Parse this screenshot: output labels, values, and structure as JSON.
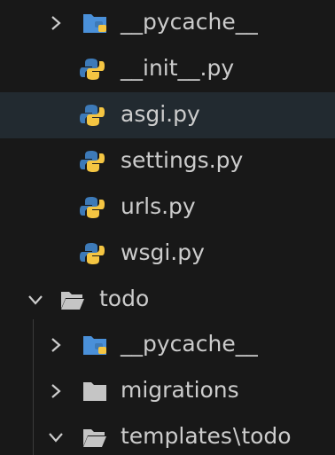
{
  "explorer": {
    "items": [
      {
        "label": "__pycache__",
        "type": "folder-python",
        "chevron": "chevron-right-icon"
      },
      {
        "label": "__init__.py",
        "type": "python-file"
      },
      {
        "label": "asgi.py",
        "type": "python-file",
        "selected": true
      },
      {
        "label": "settings.py",
        "type": "python-file"
      },
      {
        "label": "urls.py",
        "type": "python-file"
      },
      {
        "label": "wsgi.py",
        "type": "python-file"
      },
      {
        "label": "todo",
        "type": "folder-open",
        "chevron": "chevron-down-icon"
      },
      {
        "label": "__pycache__",
        "type": "folder-python",
        "chevron": "chevron-right-icon"
      },
      {
        "label": "migrations",
        "type": "folder",
        "chevron": "chevron-right-icon"
      },
      {
        "label_parts": [
          "templates",
          "\\",
          "todo"
        ],
        "type": "folder-open",
        "chevron": "chevron-down-icon"
      }
    ]
  },
  "colors": {
    "background": "#181818",
    "selected_row": "#222a30",
    "text": "#cccccc",
    "python_blue": "#3d7ab8",
    "python_yellow": "#f4c542",
    "folder_gray": "#c5c5c5",
    "folder_python_blue": "#4a90d9"
  }
}
